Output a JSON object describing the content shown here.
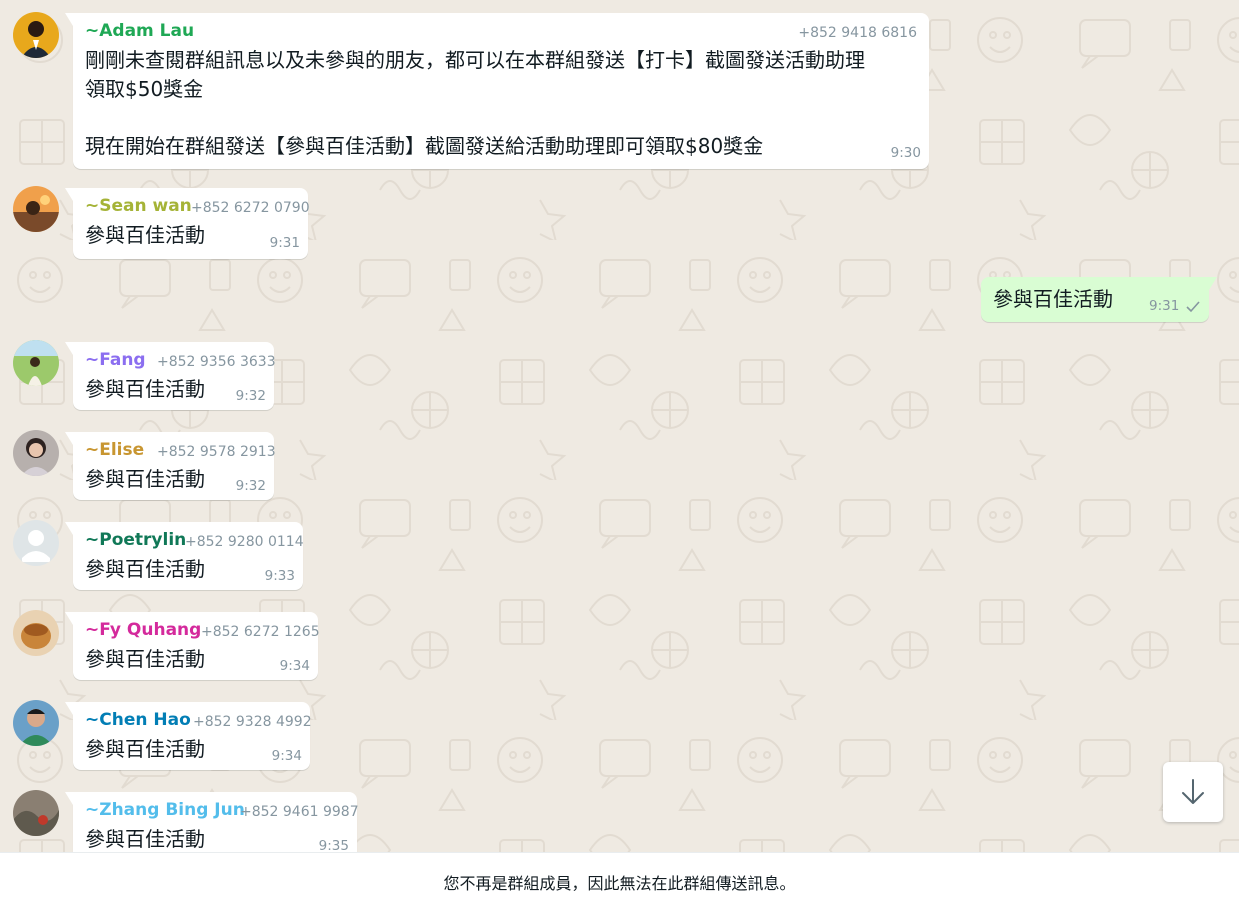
{
  "messages": [
    {
      "sender": "~Adam Lau",
      "sender_color": "#1fa855",
      "phone": "+852 9418 6816",
      "lines": [
        "剛剛未查閱群組訊息以及未參與的朋友，都可以在本群組發送【打卡】截圖發送活動助理",
        "領取$50獎金",
        "",
        "現在開始在群組發送【參與百佳活動】截圖發送給活動助理即可領取$80獎金"
      ],
      "time": "9:30"
    },
    {
      "sender": "~Sean wan",
      "sender_color": "#a5b337",
      "phone": "+852 6272 0790",
      "text": "參與百佳活動",
      "time": "9:31"
    },
    {
      "outgoing": true,
      "text": "參與百佳活動",
      "time": "9:31",
      "status_icon": "single-check-icon"
    },
    {
      "sender": "~Fang",
      "sender_color": "#8b6ef0",
      "phone": "+852 9356 3633",
      "text": "參與百佳活動",
      "time": "9:32"
    },
    {
      "sender": "~Elise",
      "sender_color": "#c89631",
      "phone": "+852 9578 2913",
      "text": "參與百佳活動",
      "time": "9:32"
    },
    {
      "sender": "~Poetrylin",
      "sender_color": "#107857",
      "phone": "+852 9280 0114",
      "text": "參與百佳活動",
      "time": "9:33"
    },
    {
      "sender": "~Fy Quhang",
      "sender_color": "#d42a9c",
      "phone": "+852 6272 1265",
      "text": "參與百佳活動",
      "time": "9:34"
    },
    {
      "sender": "~Chen Hao",
      "sender_color": "#027eb5",
      "phone": "+852 9328 4992",
      "text": "參與百佳活動",
      "time": "9:34"
    },
    {
      "sender": "~Zhang Bing Jun",
      "sender_color": "#53bdeb",
      "phone": "+852 9461 9987",
      "text": "參與百佳活動",
      "time": "9:35"
    }
  ],
  "footer": {
    "notice": "您不再是群組成員，因此無法在此群組傳送訊息。"
  },
  "scroll_button": {
    "icon": "arrow-down-icon"
  }
}
